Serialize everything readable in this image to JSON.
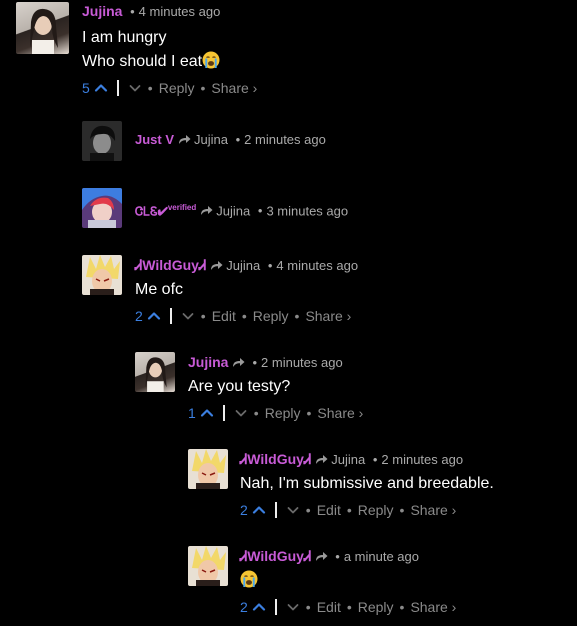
{
  "separator": "•",
  "comments": [
    {
      "author": "Jujina",
      "time": "4 minutes ago",
      "lines": [
        "I am hungry",
        "Who should I eat"
      ],
      "votes": "5",
      "reply": "Reply",
      "share": "Share ›"
    },
    {
      "author": "Just V",
      "reply_to": "Jujina",
      "time": "2 minutes ago"
    },
    {
      "author": "ᏣᏞᏋ✔",
      "badge": "verified",
      "reply_to": "Jujina",
      "time": "3 minutes ago"
    },
    {
      "author": "ᏗWildGuyᏗ",
      "reply_to": "Jujina",
      "time": "4 minutes ago",
      "text": "Me ofc",
      "votes": "2",
      "edit": "Edit",
      "reply": "Reply",
      "share": "Share ›"
    },
    {
      "author": "Jujina",
      "time": "2 minutes ago",
      "text": "Are you testy?",
      "votes": "1",
      "reply": "Reply",
      "share": "Share ›"
    },
    {
      "author": "ᏗWildGuyᏗ",
      "reply_to": "Jujina",
      "time": "2 minutes ago",
      "text": "Nah, I'm submissive and breedable.",
      "votes": "2",
      "edit": "Edit",
      "reply": "Reply",
      "share": "Share ›"
    },
    {
      "author": "ᏗWildGuyᏗ",
      "time": "a minute ago",
      "emoji": "crying-face-icon",
      "votes": "2",
      "edit": "Edit",
      "reply": "Reply",
      "share": "Share ›"
    }
  ],
  "colors": {
    "background": "#000000",
    "author": "#c85bd6",
    "votes": "#3b7fe0",
    "meta": "#aaaaaa"
  }
}
